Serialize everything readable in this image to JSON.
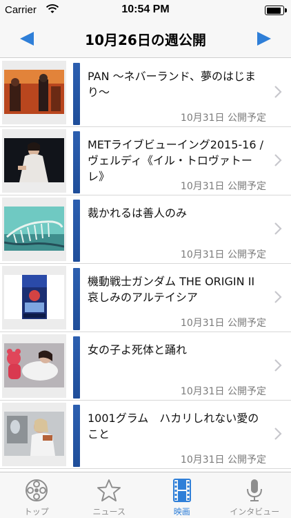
{
  "status_bar": {
    "carrier": "Carrier",
    "time": "10:54 PM",
    "battery_level": 0.92
  },
  "nav": {
    "title": "10月26日の週公開"
  },
  "movies": [
    {
      "title": "PAN ～ネバーランド、夢のはじまり～",
      "release": "10月31日 公開予定",
      "thumb_icon": "pan-poster-thumbnail"
    },
    {
      "title": "METライブビューイング2015-16 / ヴェルディ《イル・トロヴァトーレ》",
      "release": "10月31日 公開予定",
      "thumb_icon": "met-opera-thumbnail"
    },
    {
      "title": "裁かれるは善人のみ",
      "release": "10月31日 公開予定",
      "thumb_icon": "whale-skeleton-thumbnail"
    },
    {
      "title": "機動戦士ガンダム THE ORIGIN II 哀しみのアルテイシア",
      "release": "10月31日 公開予定",
      "thumb_icon": "gundam-poster-thumbnail"
    },
    {
      "title": "女の子よ死体と踊れ",
      "release": "10月31日 公開予定",
      "thumb_icon": "girl-teddy-bear-thumbnail"
    },
    {
      "title": "1001グラム　ハカリしれない愛のこと",
      "release": "10月31日 公開予定",
      "thumb_icon": "woman-scale-thumbnail"
    }
  ],
  "tabs": [
    {
      "label": "トップ",
      "icon": "film-reel-icon",
      "active": false
    },
    {
      "label": "ニュース",
      "icon": "star-icon",
      "active": false
    },
    {
      "label": "映画",
      "icon": "film-strip-icon",
      "active": true
    },
    {
      "label": "インタビュー",
      "icon": "microphone-icon",
      "active": false
    }
  ],
  "colors": {
    "accent_bar": "#2c5fb0",
    "nav_arrow": "#2f7fd8",
    "tab_active": "#2f7fd8",
    "tab_inactive": "#8e8e8e"
  }
}
